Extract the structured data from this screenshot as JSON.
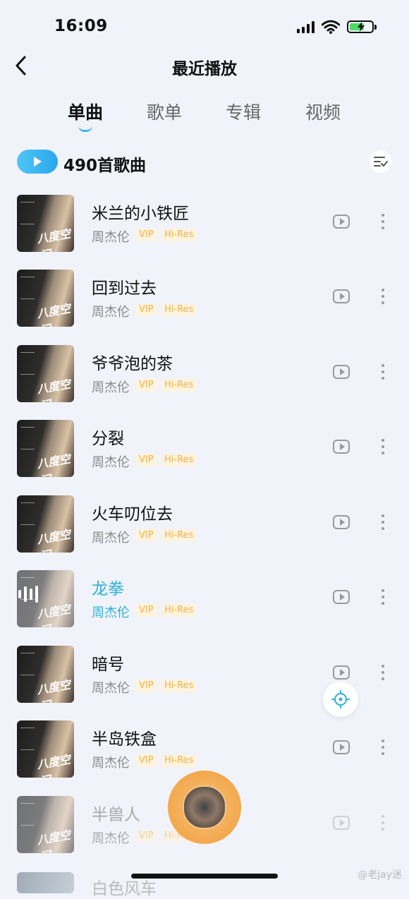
{
  "status_bar": {
    "time": "16:09"
  },
  "header": {
    "title": "最近播放"
  },
  "tabs": [
    {
      "label": "单曲",
      "active": true
    },
    {
      "label": "歌单",
      "active": false
    },
    {
      "label": "专辑",
      "active": false
    },
    {
      "label": "视频",
      "active": false
    }
  ],
  "summary": {
    "count_label": "490首歌曲"
  },
  "songs": [
    {
      "title": "米兰的小铁匠",
      "artist": "周杰伦",
      "vip": "VIP",
      "hires": "Hi-Res",
      "cover_text": "八度空间"
    },
    {
      "title": "回到过去",
      "artist": "周杰伦",
      "vip": "VIP",
      "hires": "Hi-Res",
      "cover_text": "八度空间"
    },
    {
      "title": "爷爷泡的茶",
      "artist": "周杰伦",
      "vip": "VIP",
      "hires": "Hi-Res",
      "cover_text": "八度空间"
    },
    {
      "title": "分裂",
      "artist": "周杰伦",
      "vip": "VIP",
      "hires": "Hi-Res",
      "cover_text": "八度空间"
    },
    {
      "title": "火车叨位去",
      "artist": "周杰伦",
      "vip": "VIP",
      "hires": "Hi-Res",
      "cover_text": "八度空间"
    },
    {
      "title": "龙拳",
      "artist": "周杰伦",
      "vip": "VIP",
      "hires": "Hi-Res",
      "cover_text": "八度空间",
      "playing": true
    },
    {
      "title": "暗号",
      "artist": "周杰伦",
      "vip": "VIP",
      "hires": "Hi-Res",
      "cover_text": "八度空间"
    },
    {
      "title": "半岛铁盒",
      "artist": "周杰伦",
      "vip": "VIP",
      "hires": "Hi-Res",
      "cover_text": "八度空间"
    },
    {
      "title": "半兽人",
      "artist": "周杰伦",
      "vip": "VIP",
      "hires": "Hi-Res",
      "cover_text": "八度空间"
    }
  ],
  "partial_song": {
    "title": "白色风车"
  },
  "watermark": "@老jay迷"
}
